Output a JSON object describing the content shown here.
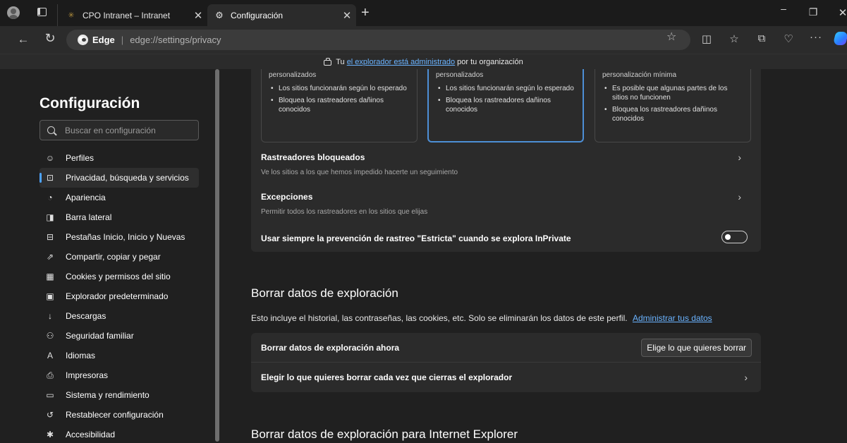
{
  "browser": {
    "tabs": [
      {
        "title": "CPO Intranet – Intranet",
        "active": false
      },
      {
        "title": "Configuración",
        "active": true
      }
    ],
    "address": {
      "site": "Edge",
      "url": "edge://settings/privacy"
    },
    "icons": {
      "profile": "avatar-icon",
      "tab_actions": "tab-actions-icon",
      "new_tab": "plus-icon",
      "back": "arrow-left-icon",
      "reload": "reload-icon",
      "favorite": "star-icon",
      "split_screen": "split-screen-icon",
      "favorites": "favorites-icon",
      "collections": "collections-icon",
      "performance": "heartbeat-icon",
      "more": "ellipsis-icon",
      "copilot": "copilot-icon"
    }
  },
  "managed_banner": {
    "prefix": "Tu",
    "link": "el explorador está administrado",
    "suffix": "por tu organización"
  },
  "sidebar": {
    "title": "Configuración",
    "search_placeholder": "Buscar en configuración",
    "items": [
      {
        "label": "Perfiles",
        "icon": "profile-icon",
        "active": false
      },
      {
        "label": "Privacidad, búsqueda y servicios",
        "icon": "lock-icon",
        "active": true
      },
      {
        "label": "Apariencia",
        "icon": "palette-icon",
        "active": false
      },
      {
        "label": "Barra lateral",
        "icon": "sidebar-icon",
        "active": false
      },
      {
        "label": "Pestañas Inicio, Inicio y Nuevas",
        "icon": "home-tab-icon",
        "active": false
      },
      {
        "label": "Compartir, copiar y pegar",
        "icon": "share-icon",
        "active": false
      },
      {
        "label": "Cookies y permisos del sitio",
        "icon": "cookies-icon",
        "active": false
      },
      {
        "label": "Explorador predeterminado",
        "icon": "browser-icon",
        "active": false
      },
      {
        "label": "Descargas",
        "icon": "download-icon",
        "active": false
      },
      {
        "label": "Seguridad familiar",
        "icon": "family-icon",
        "active": false
      },
      {
        "label": "Idiomas",
        "icon": "language-icon",
        "active": false
      },
      {
        "label": "Impresoras",
        "icon": "printer-icon",
        "active": false
      },
      {
        "label": "Sistema y rendimiento",
        "icon": "laptop-icon",
        "active": false
      },
      {
        "label": "Restablecer configuración",
        "icon": "reset-icon",
        "active": false
      },
      {
        "label": "Accesibilidad",
        "icon": "accessibility-icon",
        "active": false
      }
    ]
  },
  "tracking_cards": [
    {
      "top": "personalizados",
      "bullets": [
        "Los sitios funcionarán según lo esperado",
        "Bloquea los rastreadores dañinos conocidos"
      ],
      "selected": false
    },
    {
      "top": "personalizados",
      "bullets": [
        "Los sitios funcionarán según lo esperado",
        "Bloquea los rastreadores dañinos conocidos"
      ],
      "selected": true
    },
    {
      "top": "personalización mínima",
      "bullets": [
        "Es posible que algunas partes de los sitios no funcionen",
        "Bloquea los rastreadores dañinos conocidos"
      ],
      "selected": false
    }
  ],
  "tracking_rows": {
    "blocked": {
      "title": "Rastreadores bloqueados",
      "desc": "Ve los sitios a los que hemos impedido hacerte un seguimiento"
    },
    "exceptions": {
      "title": "Excepciones",
      "desc": "Permitir todos los rastreadores en los sitios que elijas"
    },
    "strict": {
      "title": "Usar siempre la prevención de rastreo \"Estricta\" cuando se explora InPrivate",
      "enabled": false
    }
  },
  "clear_section": {
    "title": "Borrar datos de exploración",
    "desc": "Esto incluye el historial, las contraseñas, las cookies, etc. Solo se eliminarán los datos de este perfil.",
    "desc_link": "Administrar tus datos",
    "now_label": "Borrar datos de exploración ahora",
    "now_button": "Elige lo que quieres borrar",
    "on_close_label": "Elegir lo que quieres borrar cada vez que cierras el explorador"
  },
  "ie_section": {
    "title": "Borrar datos de exploración para Internet Explorer"
  },
  "colors": {
    "accent": "#4da3ff",
    "link": "#6ab3ff",
    "selected_card_border": "#4d8fd6",
    "background": "#202020",
    "card": "#2b2b2b"
  }
}
